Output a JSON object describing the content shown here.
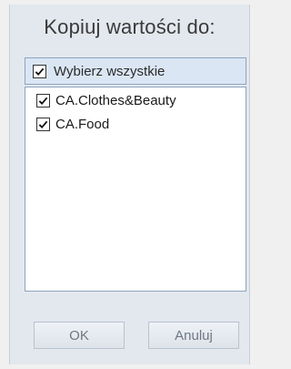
{
  "dialog": {
    "title": "Kopiuj wartości do:",
    "select_all": {
      "label": "Wybierz wszystkie",
      "checked": true
    },
    "items": [
      {
        "label": "CA.Clothes&Beauty",
        "checked": true
      },
      {
        "label": "CA.Food",
        "checked": true
      }
    ],
    "buttons": {
      "ok": "OK",
      "cancel": "Anuluj"
    }
  },
  "icons": {
    "checkbox_mark": "checkmark-icon"
  }
}
